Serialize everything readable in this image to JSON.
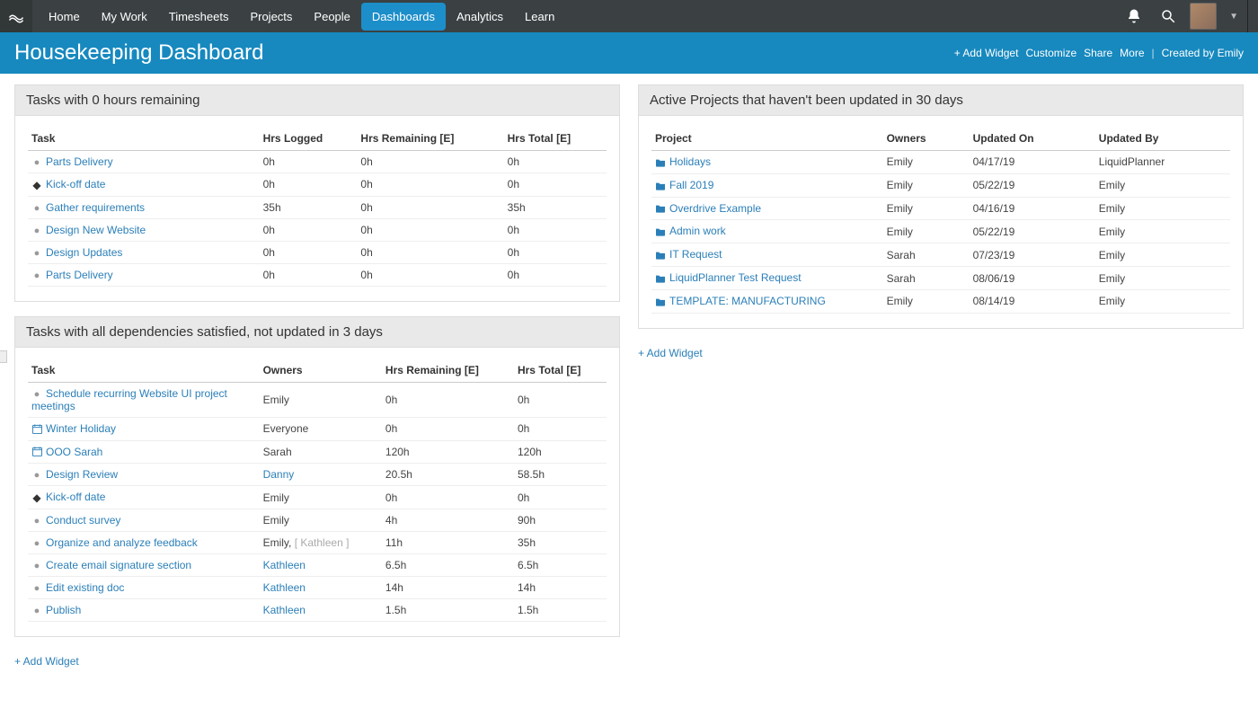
{
  "nav": {
    "items": [
      "Home",
      "My Work",
      "Timesheets",
      "Projects",
      "People",
      "Dashboards",
      "Analytics",
      "Learn"
    ],
    "active_index": 5
  },
  "titlebar": {
    "title": "Housekeeping Dashboard",
    "actions": {
      "add_widget": "+ Add Widget",
      "customize": "Customize",
      "share": "Share",
      "more": "More",
      "created_by": "Created by Emily"
    }
  },
  "widgets": {
    "w1": {
      "title": "Tasks with 0 hours remaining",
      "columns": [
        "Task",
        "Hrs Logged",
        "Hrs Remaining [E]",
        "Hrs Total [E]"
      ],
      "rows": [
        {
          "icon": "dot",
          "task": "Parts Delivery",
          "logged": "0h",
          "remaining": "0h",
          "total": "0h"
        },
        {
          "icon": "diamond",
          "task": "Kick-off date",
          "logged": "0h",
          "remaining": "0h",
          "total": "0h"
        },
        {
          "icon": "dot",
          "task": "Gather requirements",
          "logged": "35h",
          "remaining": "0h",
          "total": "35h"
        },
        {
          "icon": "dot",
          "task": "Design New Website",
          "logged": "0h",
          "remaining": "0h",
          "total": "0h"
        },
        {
          "icon": "dot",
          "task": "Design Updates",
          "logged": "0h",
          "remaining": "0h",
          "total": "0h"
        },
        {
          "icon": "dot",
          "task": "Parts Delivery",
          "logged": "0h",
          "remaining": "0h",
          "total": "0h"
        }
      ]
    },
    "w2": {
      "title": "Tasks with all dependencies satisfied, not updated in 3 days",
      "columns": [
        "Task",
        "Owners",
        "Hrs Remaining [E]",
        "Hrs Total [E]"
      ],
      "rows": [
        {
          "icon": "dot",
          "task": "Schedule recurring Website UI project meetings",
          "owners": "Emily",
          "owners_link": false,
          "remaining": "0h",
          "total": "0h"
        },
        {
          "icon": "cal",
          "task": "Winter Holiday",
          "owners": "Everyone",
          "owners_link": false,
          "remaining": "0h",
          "total": "0h"
        },
        {
          "icon": "cal",
          "task": "OOO Sarah",
          "owners": "Sarah",
          "owners_link": false,
          "remaining": "120h",
          "total": "120h"
        },
        {
          "icon": "dot",
          "task": "Design Review",
          "owners": "Danny",
          "owners_link": true,
          "remaining": "20.5h",
          "total": "58.5h"
        },
        {
          "icon": "diamond",
          "task": "Kick-off date",
          "owners": "Emily",
          "owners_link": false,
          "remaining": "0h",
          "total": "0h"
        },
        {
          "icon": "dot",
          "task": "Conduct survey",
          "owners": "Emily",
          "owners_link": false,
          "remaining": "4h",
          "total": "90h"
        },
        {
          "icon": "dot",
          "task": "Organize and analyze feedback",
          "owners": "Emily, ",
          "owners_extra": "[ Kathleen ]",
          "owners_link": false,
          "remaining": "11h",
          "total": "35h"
        },
        {
          "icon": "dot",
          "task": "Create email signature section",
          "owners": "Kathleen",
          "owners_link": true,
          "remaining": "6.5h",
          "total": "6.5h"
        },
        {
          "icon": "dot",
          "task": "Edit existing doc",
          "owners": "Kathleen",
          "owners_link": true,
          "remaining": "14h",
          "total": "14h"
        },
        {
          "icon": "dot",
          "task": "Publish",
          "owners": "Kathleen",
          "owners_link": true,
          "remaining": "1.5h",
          "total": "1.5h"
        }
      ]
    },
    "w3": {
      "title": "Active Projects that haven't been updated in 30 days",
      "columns": [
        "Project",
        "Owners",
        "Updated On",
        "Updated By"
      ],
      "rows": [
        {
          "project": "Holidays",
          "owners": "Emily",
          "updated_on": "04/17/19",
          "updated_by": "LiquidPlanner"
        },
        {
          "project": "Fall 2019",
          "owners": "Emily",
          "updated_on": "05/22/19",
          "updated_by": "Emily"
        },
        {
          "project": "Overdrive Example",
          "owners": "Emily",
          "updated_on": "04/16/19",
          "updated_by": "Emily"
        },
        {
          "project": "Admin work",
          "owners": "Emily",
          "updated_on": "05/22/19",
          "updated_by": "Emily"
        },
        {
          "project": "IT Request",
          "owners": "Sarah",
          "updated_on": "07/23/19",
          "updated_by": "Emily"
        },
        {
          "project": "LiquidPlanner Test Request",
          "owners": "Sarah",
          "updated_on": "08/06/19",
          "updated_by": "Emily"
        },
        {
          "project": "TEMPLATE: MANUFACTURING",
          "owners": "Emily",
          "updated_on": "08/14/19",
          "updated_by": "Emily"
        }
      ]
    }
  },
  "links": {
    "add_widget": "+ Add Widget"
  }
}
